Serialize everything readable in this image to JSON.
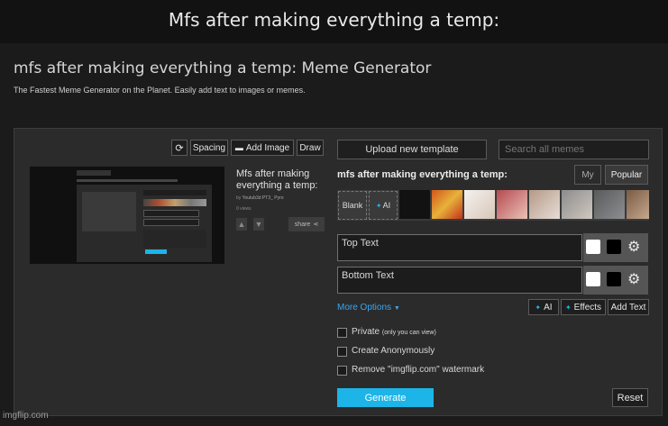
{
  "caption": "Mfs after making everything a temp:",
  "page": {
    "title": "mfs after making everything a temp: Meme Generator",
    "subtitle": "The Fastest Meme Generator on the Planet. Easily add text to images or memes."
  },
  "toolbar": {
    "spacing": "Spacing",
    "add_image": "Add Image",
    "draw": "Draw"
  },
  "preview": {
    "title": "Mfs after making everything a temp:",
    "author_prefix": "by",
    "author": "Youtub3d PT3_ Pyro",
    "views": "0 views",
    "share": "share"
  },
  "right": {
    "upload": "Upload new template",
    "search_placeholder": "Search all memes",
    "template_title": "mfs after making everything a temp:",
    "tab_my": "My",
    "tab_popular": "Popular",
    "blank": "Blank",
    "ai": "AI",
    "top_text": "Top Text",
    "bottom_text": "Bottom Text",
    "more_options": "More Options",
    "ai_btn": "AI",
    "effects": "Effects",
    "add_text": "Add Text",
    "private": "Private",
    "private_note": "(only you can view)",
    "anon": "Create Anonymously",
    "watermark": "Remove \"imgflip.com\" watermark",
    "generate": "Generate",
    "reset": "Reset"
  },
  "watermark": "imgflip.com",
  "colors": {
    "accent": "#1db4e8",
    "link": "#3aa6f0",
    "panel": "#2b2b2b"
  }
}
